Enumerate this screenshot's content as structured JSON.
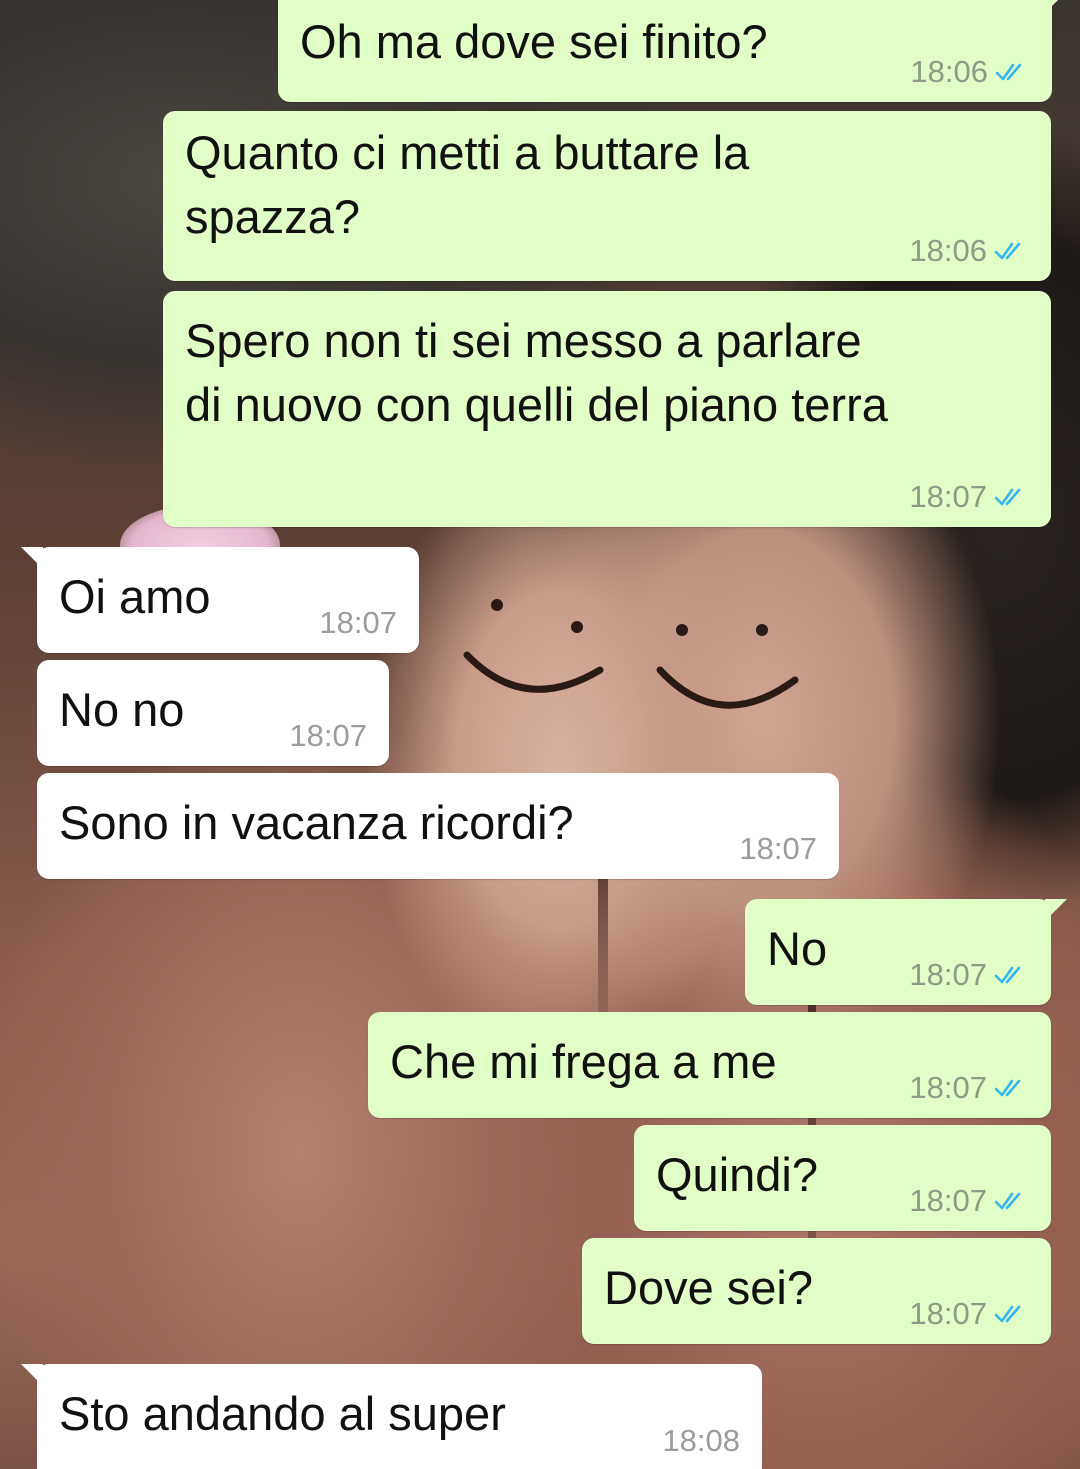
{
  "messages": [
    {
      "direction": "out",
      "text": "Oh ma dove sei finito?",
      "time": "18:06",
      "status_icon": "double-check-read-icon"
    },
    {
      "direction": "out",
      "text": "Quanto ci metti a buttare la\nspazza?",
      "time": "18:06",
      "status_icon": "double-check-read-icon"
    },
    {
      "direction": "out",
      "text": "Spero non ti sei messo a parlare\ndi nuovo con quelli del piano terra",
      "time": "18:07",
      "status_icon": "double-check-read-icon"
    },
    {
      "direction": "in",
      "text": "Oi amo",
      "time": "18:07"
    },
    {
      "direction": "in",
      "text": "No no",
      "time": "18:07"
    },
    {
      "direction": "in",
      "text": "Sono in vacanza ricordi?",
      "time": "18:07"
    },
    {
      "direction": "out",
      "text": "No",
      "time": "18:07",
      "status_icon": "double-check-read-icon"
    },
    {
      "direction": "out",
      "text": "Che mi frega a me",
      "time": "18:07",
      "status_icon": "double-check-read-icon"
    },
    {
      "direction": "out",
      "text": "Quindi?",
      "time": "18:07",
      "status_icon": "double-check-read-icon"
    },
    {
      "direction": "out",
      "text": "Dove sei?",
      "time": "18:07",
      "status_icon": "double-check-read-icon"
    },
    {
      "direction": "in",
      "text": "Sto andando al super",
      "time": "18:08"
    }
  ],
  "colors": {
    "outgoing_bubble": "#e1fec6",
    "incoming_bubble": "#ffffff",
    "read_ticks": "#34b7f1",
    "time_text": "#8d9a86"
  }
}
